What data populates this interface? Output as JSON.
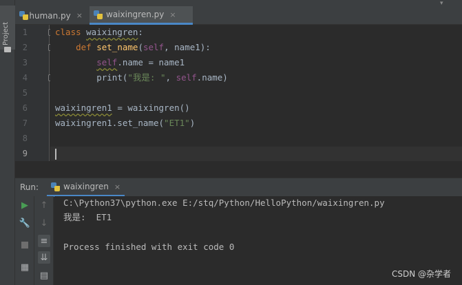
{
  "sidebar": {
    "project_label": "Project"
  },
  "tabs": [
    {
      "label": "human.py",
      "close": "×",
      "active": false
    },
    {
      "label": "waixingren.py",
      "close": "×",
      "active": true
    }
  ],
  "editor": {
    "line_numbers": [
      "1",
      "2",
      "3",
      "4",
      "5",
      "6",
      "7",
      "8",
      "9"
    ],
    "lines": {
      "l1_kw": "class ",
      "l1_name": "waixingren",
      "l1_colon": ":",
      "l2_indent": "    ",
      "l2_kw": "def ",
      "l2_fn": "set_name",
      "l2_open": "(",
      "l2_self": "self",
      "l2_rest": ", name1):",
      "l3_indent": "        ",
      "l3_self": "self",
      "l3_rest": ".name = name1",
      "l4_indent": "        ",
      "l4_fn": "print",
      "l4_open": "(",
      "l4_str": "\"我是: \"",
      "l4_comma": ", ",
      "l4_self": "self",
      "l4_rest": ".name)",
      "l6_var": "waixingren1",
      "l6_rest": " = waixingren()",
      "l7_pre": "waixingren1.set_name(",
      "l7_str": "\"ET1\"",
      "l7_post": ")"
    }
  },
  "run": {
    "label": "Run:",
    "tab_label": "waixingren",
    "tab_close": "×",
    "console_lines": [
      "C:\\Python37\\python.exe E:/stq/Python/HelloPython/waixingren.py",
      "我是:  ET1",
      "",
      "Process finished with exit code 0"
    ]
  },
  "watermark": "CSDN @杂学者"
}
